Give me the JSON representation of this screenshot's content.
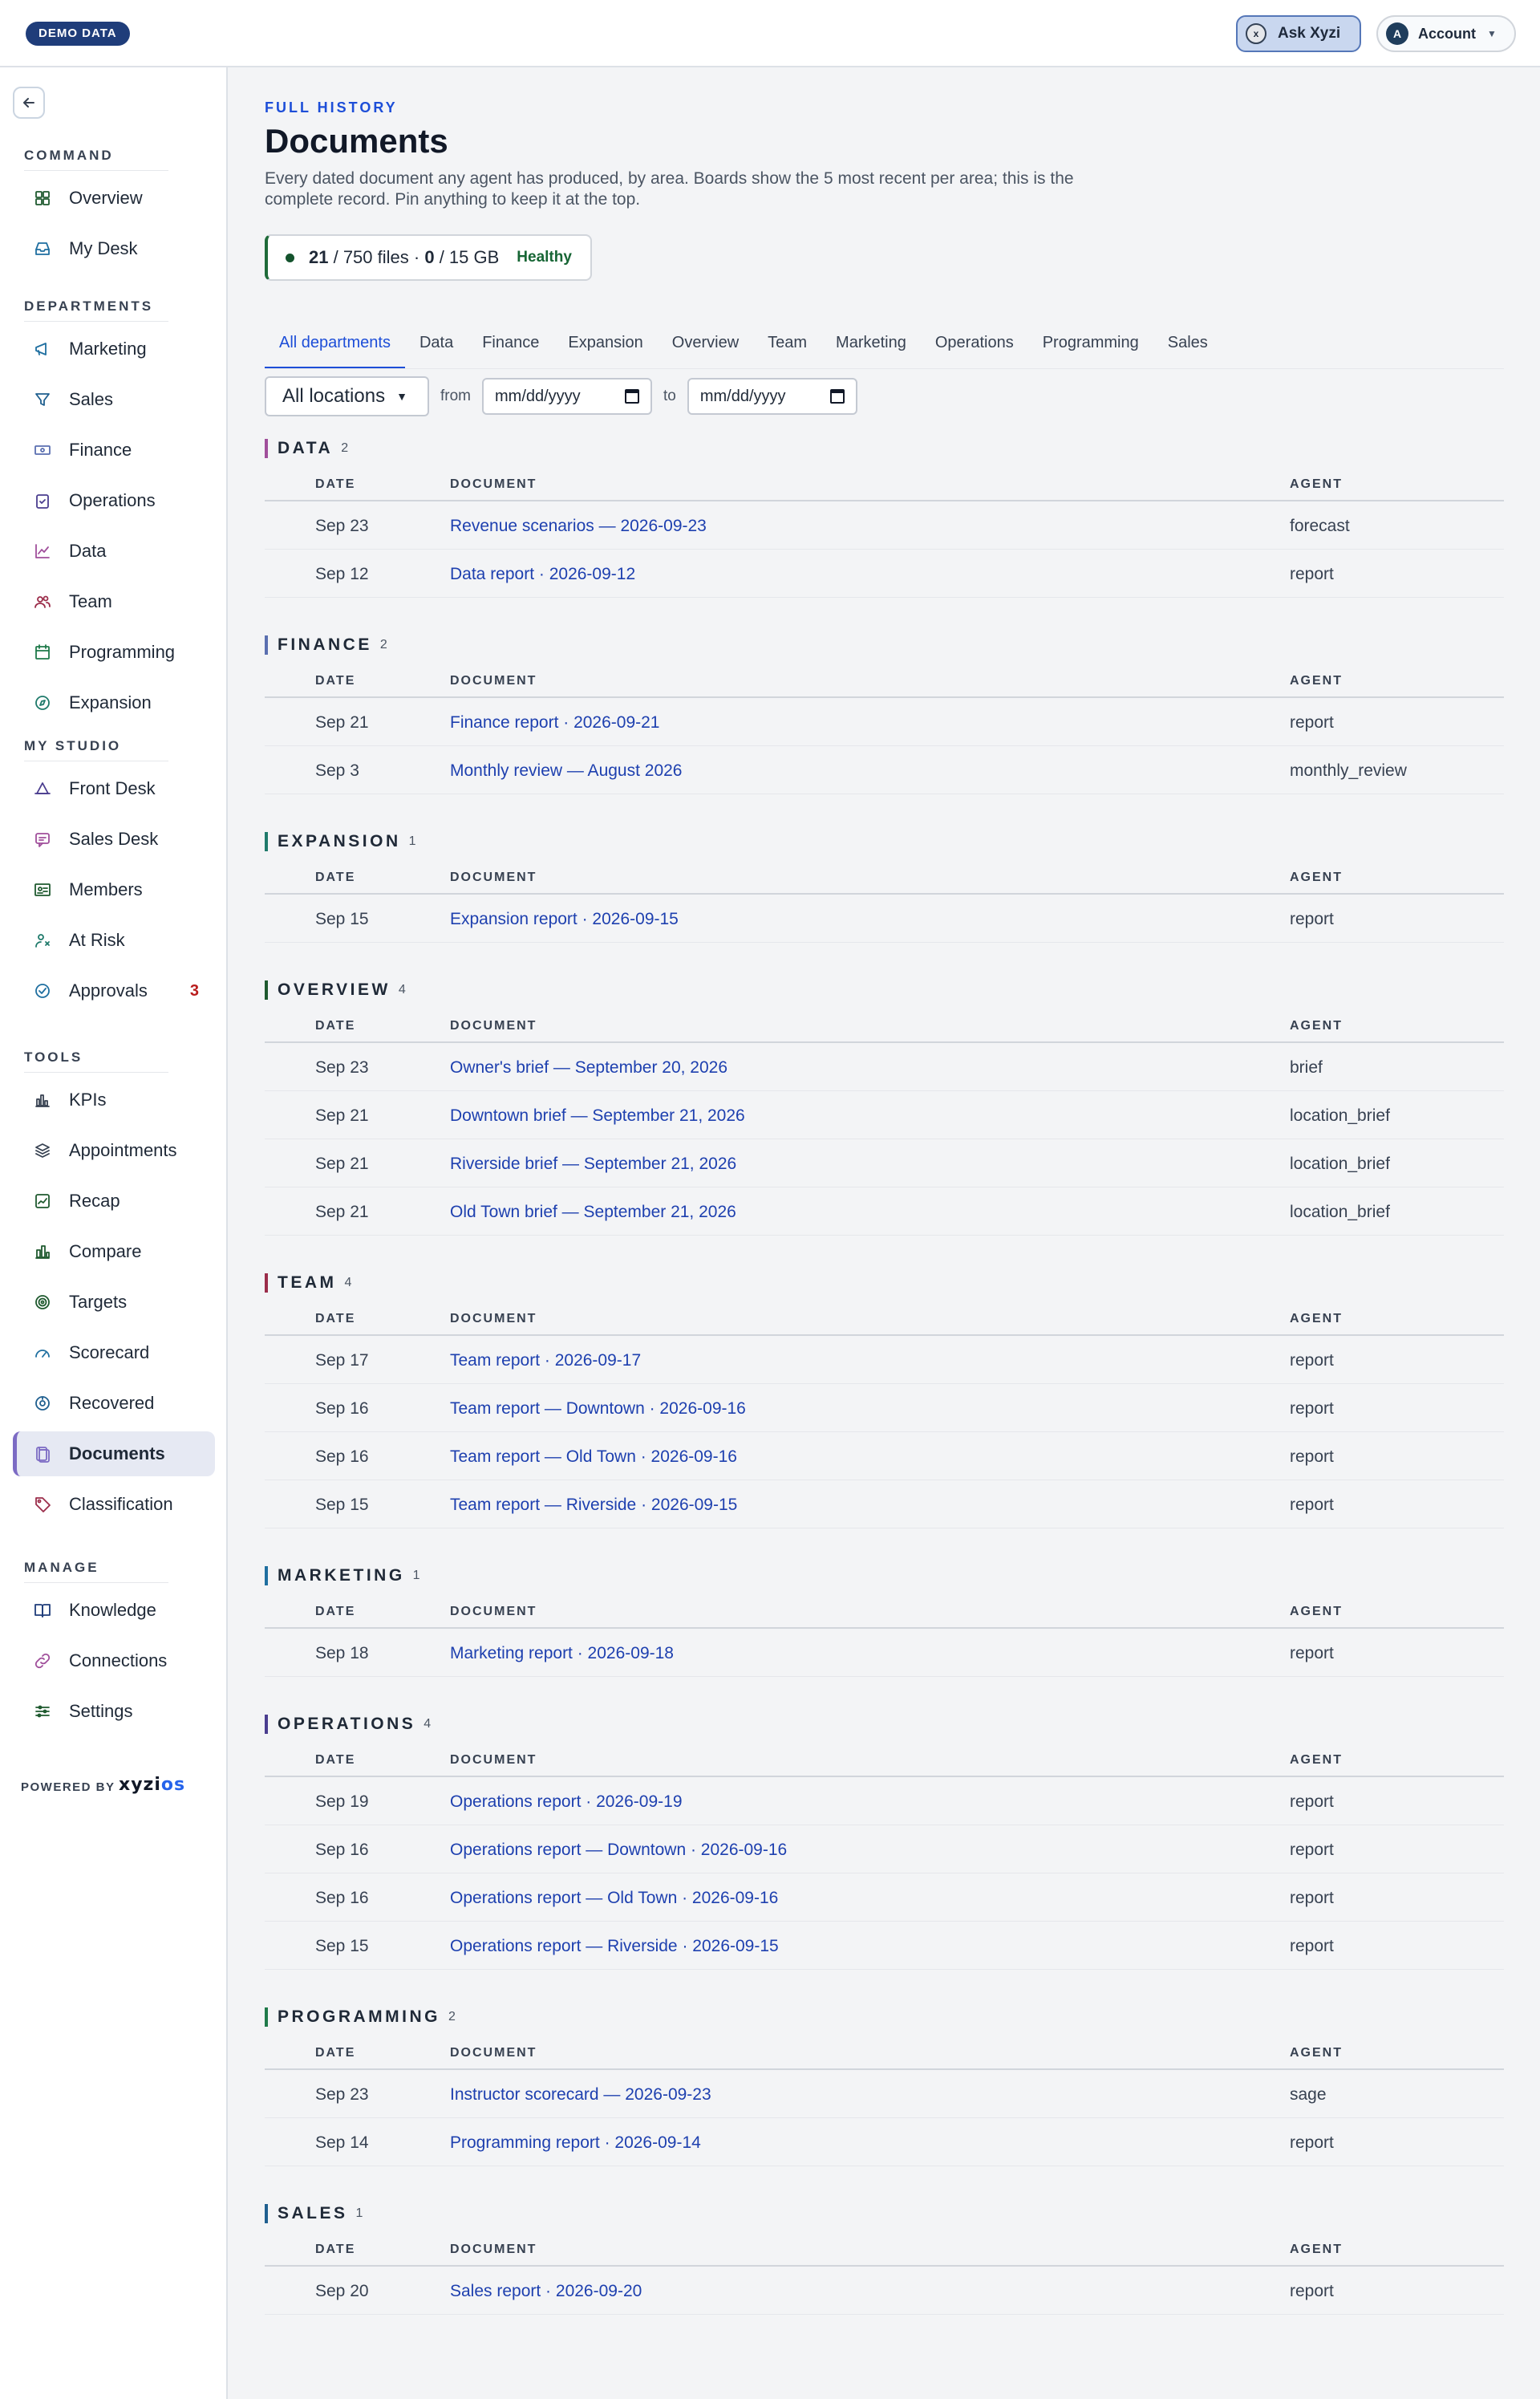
{
  "topbar": {
    "demo_badge": "DEMO DATA",
    "ask_label": "Ask Xyzi",
    "ask_icon": "xyzi-icon",
    "account_label": "Account",
    "account_initial": "A"
  },
  "sidebar": {
    "sections": [
      {
        "label": "COMMAND",
        "items": [
          {
            "label": "Overview",
            "icon": "grid-icon"
          },
          {
            "label": "My Desk",
            "icon": "inbox-icon"
          }
        ]
      },
      {
        "label": "DEPARTMENTS",
        "items": [
          {
            "label": "Marketing",
            "icon": "megaphone-icon"
          },
          {
            "label": "Sales",
            "icon": "funnel-icon"
          },
          {
            "label": "Finance",
            "icon": "banknote-icon"
          },
          {
            "label": "Operations",
            "icon": "clipboard-icon"
          },
          {
            "label": "Data",
            "icon": "line-chart-icon"
          },
          {
            "label": "Team",
            "icon": "users-icon"
          },
          {
            "label": "Programming",
            "icon": "calendar-icon"
          },
          {
            "label": "Expansion",
            "icon": "compass-icon"
          }
        ]
      },
      {
        "label": "MY STUDIO",
        "items": [
          {
            "label": "Front Desk",
            "icon": "bell-icon"
          },
          {
            "label": "Sales Desk",
            "icon": "message-icon"
          },
          {
            "label": "Members",
            "icon": "id-card-icon"
          },
          {
            "label": "At Risk",
            "icon": "user-alert-icon"
          },
          {
            "label": "Approvals",
            "icon": "check-circle-icon",
            "badge": "3"
          }
        ]
      },
      {
        "label": "TOOLS",
        "items": [
          {
            "label": "KPIs",
            "icon": "bar-chart-icon"
          },
          {
            "label": "Appointments",
            "icon": "layers-icon"
          },
          {
            "label": "Recap",
            "icon": "trend-icon"
          },
          {
            "label": "Compare",
            "icon": "columns-icon"
          },
          {
            "label": "Targets",
            "icon": "target-icon"
          },
          {
            "label": "Scorecard",
            "icon": "gauge-icon"
          },
          {
            "label": "Recovered",
            "icon": "recover-icon"
          },
          {
            "label": "Documents",
            "icon": "documents-icon",
            "active": true
          },
          {
            "label": "Classification",
            "icon": "tag-icon"
          }
        ]
      },
      {
        "label": "MANAGE",
        "items": [
          {
            "label": "Knowledge",
            "icon": "book-icon"
          },
          {
            "label": "Connections",
            "icon": "link-icon"
          },
          {
            "label": "Settings",
            "icon": "sliders-icon"
          }
        ]
      }
    ],
    "powered_by": "POWERED BY",
    "brand_a": "xyzi",
    "brand_b": "os"
  },
  "main": {
    "eyebrow": "FULL HISTORY",
    "title": "Documents",
    "subtitle": "Every dated document any agent has produced, by area. Boards show the 5 most recent per area; this is the complete record. Pin anything to keep it at the top.",
    "storage": {
      "files_used": "21",
      "files_rest": " / 750 files · ",
      "gb_used": "0",
      "gb_rest": " / 15 GB",
      "status": "Healthy"
    },
    "tabs": [
      "All departments",
      "Data",
      "Finance",
      "Expansion",
      "Overview",
      "Team",
      "Marketing",
      "Operations",
      "Programming",
      "Sales"
    ],
    "filters": {
      "location": "All locations",
      "from_label": "from",
      "to_label": "to",
      "from_placeholder": "mm/dd/yyyy",
      "to_placeholder": "mm/dd/yyyy"
    },
    "columns": {
      "date": "DATE",
      "document": "DOCUMENT",
      "agent": "AGENT"
    },
    "groups": [
      {
        "name": "DATA",
        "count": "2",
        "color": "#a04f9b",
        "rows": [
          {
            "date": "Sep 23",
            "doc": "Revenue scenarios — 2026-09-23",
            "agent": "forecast"
          },
          {
            "date": "Sep 12",
            "doc": "Data report · 2026-09-12",
            "agent": "report"
          }
        ]
      },
      {
        "name": "FINANCE",
        "count": "2",
        "color": "#5a6fb0",
        "rows": [
          {
            "date": "Sep 21",
            "doc": "Finance report · 2026-09-21",
            "agent": "report"
          },
          {
            "date": "Sep 3",
            "doc": "Monthly review — August 2026",
            "agent": "monthly_review"
          }
        ]
      },
      {
        "name": "EXPANSION",
        "count": "1",
        "color": "#1f7a6b",
        "rows": [
          {
            "date": "Sep 15",
            "doc": "Expansion report · 2026-09-15",
            "agent": "report"
          }
        ]
      },
      {
        "name": "OVERVIEW",
        "count": "4",
        "color": "#1f5a2f",
        "rows": [
          {
            "date": "Sep 23",
            "doc": "Owner's brief — September 20, 2026",
            "agent": "brief"
          },
          {
            "date": "Sep 21",
            "doc": "Downtown brief — September 21, 2026",
            "agent": "location_brief"
          },
          {
            "date": "Sep 21",
            "doc": "Riverside brief — September 21, 2026",
            "agent": "location_brief"
          },
          {
            "date": "Sep 21",
            "doc": "Old Town brief — September 21, 2026",
            "agent": "location_brief"
          }
        ]
      },
      {
        "name": "TEAM",
        "count": "4",
        "color": "#9b2d4a",
        "rows": [
          {
            "date": "Sep 17",
            "doc": "Team report · 2026-09-17",
            "agent": "report"
          },
          {
            "date": "Sep 16",
            "doc": "Team report — Downtown · 2026-09-16",
            "agent": "report"
          },
          {
            "date": "Sep 16",
            "doc": "Team report — Old Town · 2026-09-16",
            "agent": "report"
          },
          {
            "date": "Sep 15",
            "doc": "Team report — Riverside · 2026-09-15",
            "agent": "report"
          }
        ]
      },
      {
        "name": "MARKETING",
        "count": "1",
        "color": "#1f6fa0",
        "rows": [
          {
            "date": "Sep 18",
            "doc": "Marketing report · 2026-09-18",
            "agent": "report"
          }
        ]
      },
      {
        "name": "OPERATIONS",
        "count": "4",
        "color": "#4a3d8f",
        "rows": [
          {
            "date": "Sep 19",
            "doc": "Operations report · 2026-09-19",
            "agent": "report"
          },
          {
            "date": "Sep 16",
            "doc": "Operations report — Downtown · 2026-09-16",
            "agent": "report"
          },
          {
            "date": "Sep 16",
            "doc": "Operations report — Old Town · 2026-09-16",
            "agent": "report"
          },
          {
            "date": "Sep 15",
            "doc": "Operations report — Riverside · 2026-09-15",
            "agent": "report"
          }
        ]
      },
      {
        "name": "PROGRAMMING",
        "count": "2",
        "color": "#1f7a4a",
        "rows": [
          {
            "date": "Sep 23",
            "doc": "Instructor scorecard — 2026-09-23",
            "agent": "sage"
          },
          {
            "date": "Sep 14",
            "doc": "Programming report · 2026-09-14",
            "agent": "report"
          }
        ]
      },
      {
        "name": "SALES",
        "count": "1",
        "color": "#1f5f8f",
        "rows": [
          {
            "date": "Sep 20",
            "doc": "Sales report · 2026-09-20",
            "agent": "report"
          }
        ]
      }
    ]
  },
  "colors": {
    "accent": "#1d4ed8",
    "brand_navy": "#1f3d7a",
    "link": "#1e40af",
    "badge_red": "#b91c1c",
    "healthy_green": "#166534"
  }
}
